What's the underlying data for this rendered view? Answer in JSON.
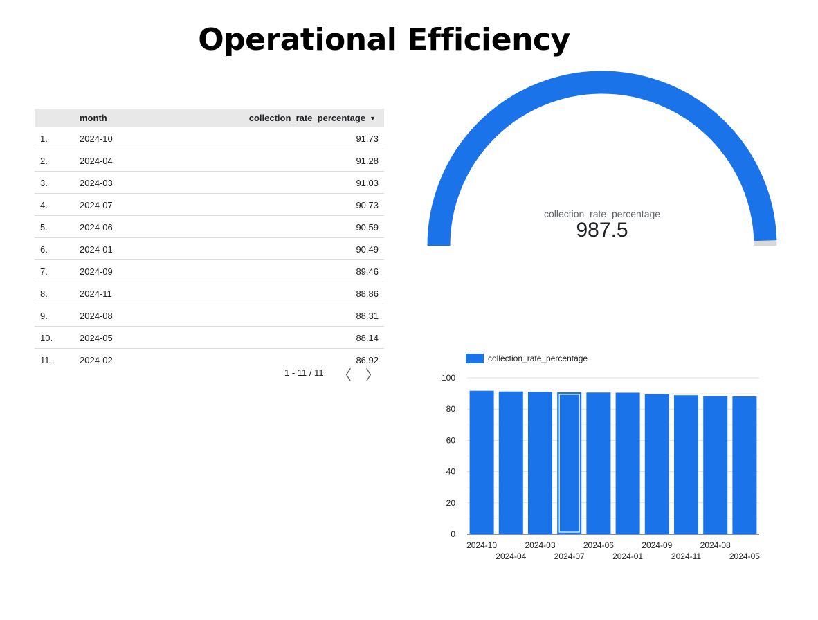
{
  "page": {
    "title": "Operational Efficiency"
  },
  "table": {
    "headers": {
      "month": "month",
      "value": "collection_rate_percentage",
      "sort_icon": "▼"
    },
    "rows": [
      {
        "idx": "1.",
        "month": "2024-10",
        "value": "91.73"
      },
      {
        "idx": "2.",
        "month": "2024-04",
        "value": "91.28"
      },
      {
        "idx": "3.",
        "month": "2024-03",
        "value": "91.03"
      },
      {
        "idx": "4.",
        "month": "2024-07",
        "value": "90.73"
      },
      {
        "idx": "5.",
        "month": "2024-06",
        "value": "90.59"
      },
      {
        "idx": "6.",
        "month": "2024-01",
        "value": "90.49"
      },
      {
        "idx": "7.",
        "month": "2024-09",
        "value": "89.46"
      },
      {
        "idx": "8.",
        "month": "2024-11",
        "value": "88.86"
      },
      {
        "idx": "9.",
        "month": "2024-08",
        "value": "88.31"
      },
      {
        "idx": "10.",
        "month": "2024-05",
        "value": "88.14"
      },
      {
        "idx": "11.",
        "month": "2024-02",
        "value": "86.92"
      }
    ],
    "pagination": {
      "text": "1 - 11 / 11",
      "prev": "〈",
      "next": "〉"
    }
  },
  "gauge": {
    "label": "collection_rate_percentage",
    "value": "987.5",
    "fill_fraction": 0.99,
    "colors": {
      "fill": "#1a73e8",
      "track": "#d9d9d9"
    }
  },
  "chart_data": {
    "type": "bar",
    "categories": [
      "2024-10",
      "2024-04",
      "2024-03",
      "2024-07",
      "2024-06",
      "2024-01",
      "2024-09",
      "2024-11",
      "2024-08",
      "2024-05"
    ],
    "series": [
      {
        "name": "collection_rate_percentage",
        "values": [
          91.73,
          91.28,
          91.03,
          90.73,
          90.59,
          90.49,
          89.46,
          88.86,
          88.31,
          88.14
        ]
      }
    ],
    "ylim": [
      0,
      100
    ],
    "yticks": [
      0,
      20,
      40,
      60,
      80,
      100
    ],
    "grid": true,
    "legend": "top-left",
    "highlighted_category": "2024-07",
    "colors": {
      "bar": "#1a73e8"
    }
  }
}
